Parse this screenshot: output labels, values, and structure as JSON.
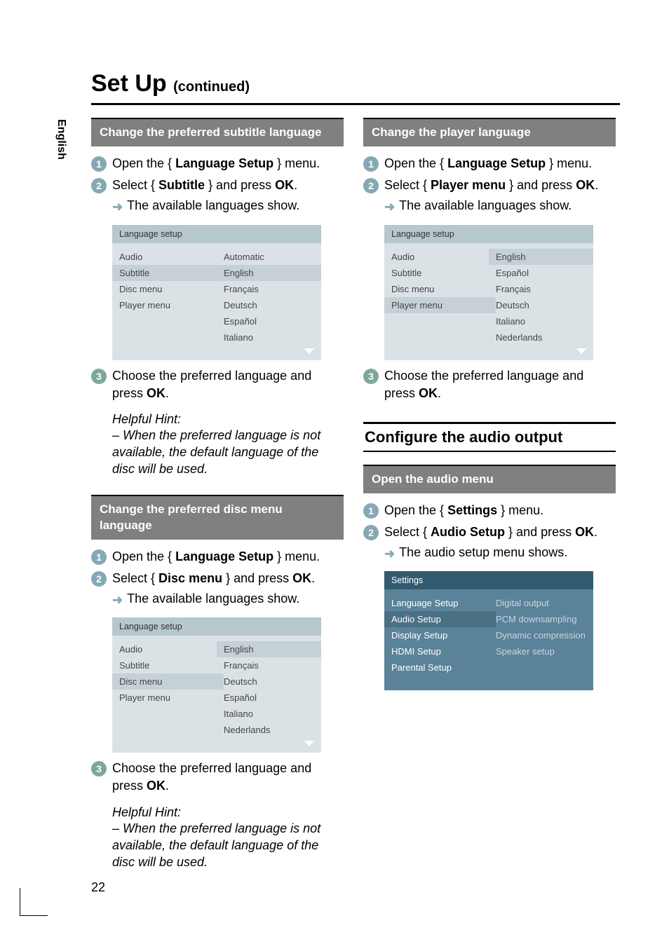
{
  "page": {
    "title": "Set Up",
    "continuedSuffix": "(continued)",
    "number": "22",
    "languageTab": "English"
  },
  "left": {
    "sec1": {
      "bar": "Change the preferred subtitle language",
      "step1_pre": "Open the { ",
      "step1_bold": "Language Setup",
      "step1_post": " } menu.",
      "step2_pre": "Select { ",
      "step2_bold1": "Subtitle",
      "step2_mid": " } and press ",
      "step2_bold2": "OK",
      "step2_post": ".",
      "step2_sub": "The available languages show.",
      "menu": {
        "title": "Language setup",
        "leftItems": [
          "Audio",
          "Subtitle",
          "Disc menu",
          "Player menu"
        ],
        "leftSelectedIndex": 1,
        "rightItems": [
          "Automatic",
          "English",
          "Français",
          "Deutsch",
          "Español",
          "Italiano"
        ],
        "rightSelectedIndex": 1
      },
      "step3_pre": "Choose the preferred language and press ",
      "step3_bold": "OK",
      "step3_post": ".",
      "hintTitle": "Helpful Hint:",
      "hintBody": "–  When the preferred language is not available, the default language of the disc will be used."
    },
    "sec2": {
      "bar": "Change the preferred disc menu language",
      "step1_pre": "Open the { ",
      "step1_bold": "Language Setup",
      "step1_post": " } menu.",
      "step2_pre": "Select { ",
      "step2_bold1": "Disc menu",
      "step2_mid": " } and press ",
      "step2_bold2": "OK",
      "step2_post": ".",
      "step2_sub": "The available languages show.",
      "menu": {
        "title": "Language setup",
        "leftItems": [
          "Audio",
          "Subtitle",
          "Disc menu",
          "Player menu"
        ],
        "leftSelectedIndex": 2,
        "rightItems": [
          "English",
          "Français",
          "Deutsch",
          "Español",
          "Italiano",
          "Nederlands"
        ],
        "rightSelectedIndex": 0
      },
      "step3_pre": "Choose the preferred language and press ",
      "step3_bold": "OK",
      "step3_post": ".",
      "hintTitle": "Helpful Hint:",
      "hintBody": "–  When the preferred language is not available, the default language of the disc will be used."
    }
  },
  "right": {
    "sec1": {
      "bar": "Change the player language",
      "step1_pre": "Open the { ",
      "step1_bold": "Language Setup",
      "step1_post": " } menu.",
      "step2_pre": "Select { ",
      "step2_bold1": "Player menu",
      "step2_mid": " } and press ",
      "step2_bold2": "OK",
      "step2_post": ".",
      "step2_sub": "The available languages show.",
      "menu": {
        "title": "Language setup",
        "leftItems": [
          "Audio",
          "Subtitle",
          "Disc menu",
          "Player menu"
        ],
        "leftSelectedIndex": 3,
        "rightItems": [
          "English",
          "Español",
          "Français",
          "Deutsch",
          "Italiano",
          "Nederlands"
        ],
        "rightSelectedIndex": 0
      },
      "step3_pre": "Choose the preferred language and press ",
      "step3_bold": "OK",
      "step3_post": "."
    },
    "h2": "Configure the audio output",
    "sec2": {
      "bar": "Open the audio menu",
      "step1_pre": "Open the { ",
      "step1_bold": "Settings",
      "step1_post": " } menu.",
      "step2_pre": "Select { ",
      "step2_bold1": "Audio Setup",
      "step2_mid": " } and press ",
      "step2_bold2": "OK",
      "step2_post": ".",
      "step2_sub": "The audio setup menu shows.",
      "menu": {
        "title": "Settings",
        "leftItems": [
          "Language Setup",
          "Audio Setup",
          "Display Setup",
          "HDMI Setup",
          "Parental Setup"
        ],
        "leftSelectedIndex": 1,
        "rightItems": [
          "Digital output",
          "PCM downsampling",
          "Dynamic compression",
          "Speaker setup"
        ],
        "rightSelectedIndex": -1
      }
    }
  },
  "numbers": {
    "n1": "1",
    "n2": "2",
    "n3": "3"
  }
}
